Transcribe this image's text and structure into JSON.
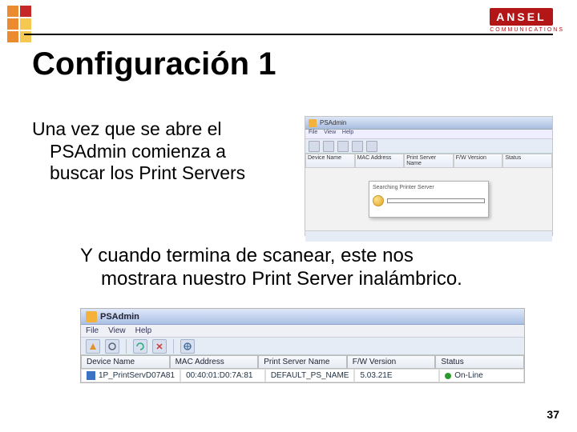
{
  "brand": {
    "name": "ANSEL",
    "sub": "COMMUNICATIONS"
  },
  "title": "Configuración 1",
  "para1": {
    "line1": "Una vez que se abre el",
    "rest": "PSAdmin comienza a buscar los Print Servers"
  },
  "para2": {
    "line1": "Y cuando termina de scanear, este nos",
    "rest": "mostrara nuestro Print Server inalámbrico."
  },
  "psadmin": {
    "title": "PSAdmin",
    "menus": [
      "File",
      "View",
      "Help"
    ],
    "toolbar_icons": [
      "wizard-icon",
      "settings-icon",
      "refresh-icon",
      "delete-icon",
      "web-icon"
    ],
    "columns_small": [
      "Device Name",
      "MAC Address",
      "Print Server Name",
      "F/W Version",
      "Status"
    ],
    "wizard_title": "Searching Printer Server",
    "columns": [
      "Device Name",
      "MAC Address",
      "Print Server Name",
      "F/W Version",
      "Status"
    ],
    "row": {
      "device": "1P_PrintServD07A81",
      "mac": "00:40:01:D0:7A:81",
      "name": "DEFAULT_PS_NAME",
      "fw": "5.03.21E",
      "status": "On-Line"
    }
  },
  "page_number": "37"
}
